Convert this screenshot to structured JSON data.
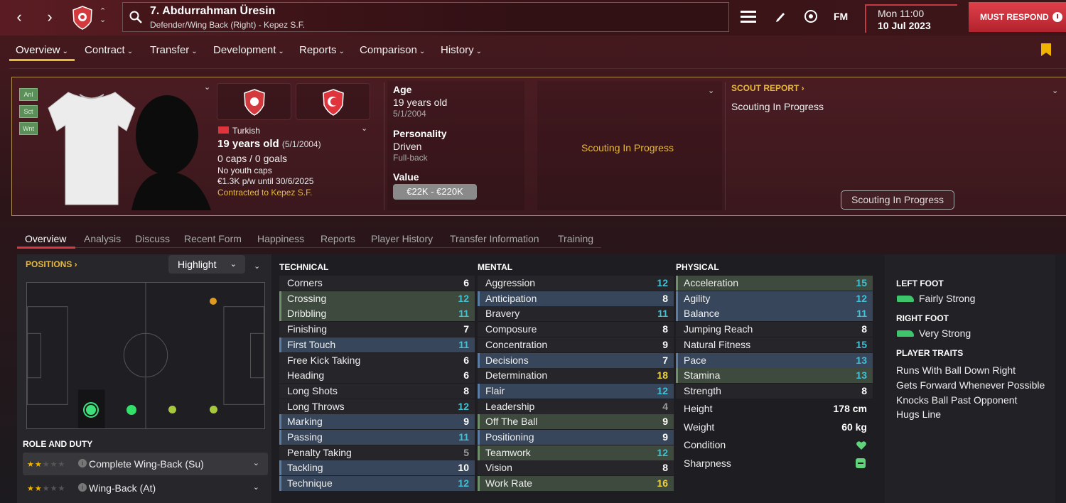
{
  "header": {
    "player_title": "7. Abdurrahman Üresin",
    "player_subtitle": "Defender/Wing Back (Right) - Kepez S.F.",
    "fm_label": "FM",
    "date_line1": "Mon 11:00",
    "date_line2": "10 Jul 2023",
    "must_respond": "MUST RESPOND"
  },
  "nav_tabs": [
    "Overview",
    "Contract",
    "Transfer",
    "Development",
    "Reports",
    "Comparison",
    "History"
  ],
  "profile": {
    "chips": [
      "Anl",
      "Sct",
      "Wnt"
    ],
    "nationality": "Turkish",
    "age_line": "19 years old",
    "age_dob": "(5/1/2004)",
    "caps": "0 caps / 0 goals",
    "youth_caps": "No youth caps",
    "wage": "€1.3K p/w until 30/6/2025",
    "contract": "Contracted to Kepez S.F.",
    "age_label": "Age",
    "age_value": "19 years old",
    "age_dob_plain": "5/1/2004",
    "personality_label": "Personality",
    "personality_value": "Driven",
    "personality_sub": "Full-back",
    "value_label": "Value",
    "value_range": "€22K - €220K",
    "center_status": "Scouting In Progress",
    "scout_report_label": "SCOUT REPORT",
    "scout_report_text": "Scouting In Progress",
    "scout_button": "Scouting In Progress"
  },
  "sub_tabs": [
    "Overview",
    "Analysis",
    "Discuss",
    "Recent Form",
    "Happiness",
    "Reports",
    "Player History",
    "Transfer Information",
    "Training"
  ],
  "positions": {
    "title": "POSITIONS",
    "dropdown": "Highlight"
  },
  "roles": {
    "title": "ROLE AND DUTY",
    "items": [
      {
        "label": "Complete Wing-Back (Su)",
        "stars": 1.5
      },
      {
        "label": "Wing-Back (At)",
        "stars": 1.5
      }
    ]
  },
  "attributes": {
    "technical_title": "TECHNICAL",
    "mental_title": "MENTAL",
    "physical_title": "PHYSICAL",
    "technical": [
      {
        "name": "Corners",
        "value": "6",
        "hl": "none"
      },
      {
        "name": "Crossing",
        "value": "12",
        "hl": "green"
      },
      {
        "name": "Dribbling",
        "value": "11",
        "hl": "green"
      },
      {
        "name": "Finishing",
        "value": "7",
        "hl": "none"
      },
      {
        "name": "First Touch",
        "value": "11",
        "hl": "blue"
      },
      {
        "name": "Free Kick Taking",
        "value": "6",
        "hl": "none"
      },
      {
        "name": "Heading",
        "value": "6",
        "hl": "none"
      },
      {
        "name": "Long Shots",
        "value": "8",
        "hl": "none"
      },
      {
        "name": "Long Throws",
        "value": "12",
        "hl": "none"
      },
      {
        "name": "Marking",
        "value": "9",
        "hl": "blue"
      },
      {
        "name": "Passing",
        "value": "11",
        "hl": "blue"
      },
      {
        "name": "Penalty Taking",
        "value": "5",
        "hl": "none"
      },
      {
        "name": "Tackling",
        "value": "10",
        "hl": "blue"
      },
      {
        "name": "Technique",
        "value": "12",
        "hl": "blue"
      }
    ],
    "mental": [
      {
        "name": "Aggression",
        "value": "12",
        "hl": "none"
      },
      {
        "name": "Anticipation",
        "value": "8",
        "hl": "blue"
      },
      {
        "name": "Bravery",
        "value": "11",
        "hl": "none"
      },
      {
        "name": "Composure",
        "value": "8",
        "hl": "none"
      },
      {
        "name": "Concentration",
        "value": "9",
        "hl": "none"
      },
      {
        "name": "Decisions",
        "value": "7",
        "hl": "blue"
      },
      {
        "name": "Determination",
        "value": "18",
        "hl": "none"
      },
      {
        "name": "Flair",
        "value": "12",
        "hl": "blue"
      },
      {
        "name": "Leadership",
        "value": "4",
        "hl": "none"
      },
      {
        "name": "Off The Ball",
        "value": "9",
        "hl": "green"
      },
      {
        "name": "Positioning",
        "value": "9",
        "hl": "blue"
      },
      {
        "name": "Teamwork",
        "value": "12",
        "hl": "green"
      },
      {
        "name": "Vision",
        "value": "8",
        "hl": "none"
      },
      {
        "name": "Work Rate",
        "value": "16",
        "hl": "green"
      }
    ],
    "physical": [
      {
        "name": "Acceleration",
        "value": "15",
        "hl": "green"
      },
      {
        "name": "Agility",
        "value": "12",
        "hl": "blue"
      },
      {
        "name": "Balance",
        "value": "11",
        "hl": "blue"
      },
      {
        "name": "Jumping Reach",
        "value": "8",
        "hl": "none"
      },
      {
        "name": "Natural Fitness",
        "value": "15",
        "hl": "none"
      },
      {
        "name": "Pace",
        "value": "13",
        "hl": "blue"
      },
      {
        "name": "Stamina",
        "value": "13",
        "hl": "green"
      },
      {
        "name": "Strength",
        "value": "8",
        "hl": "none"
      }
    ],
    "physical_extra": [
      {
        "name": "Height",
        "value": "178 cm"
      },
      {
        "name": "Weight",
        "value": "60 kg"
      },
      {
        "name": "Condition",
        "value": ""
      },
      {
        "name": "Sharpness",
        "value": ""
      }
    ]
  },
  "feet": {
    "left_title": "LEFT FOOT",
    "left_value": "Fairly Strong",
    "right_title": "RIGHT FOOT",
    "right_value": "Very Strong"
  },
  "traits": {
    "title": "PLAYER TRAITS",
    "items": [
      "Runs With Ball Down Right",
      "Gets Forward Whenever Possible",
      "Knocks Ball Past Opponent",
      "Hugs Line"
    ]
  },
  "colors": {
    "accent_gold": "#e7b93d",
    "accent_red": "#d83a42",
    "value_cyan": "#3fc1d6",
    "value_yellow": "#f0d23a",
    "value_white": "#ffffff",
    "value_grey": "#9a9a9a"
  }
}
